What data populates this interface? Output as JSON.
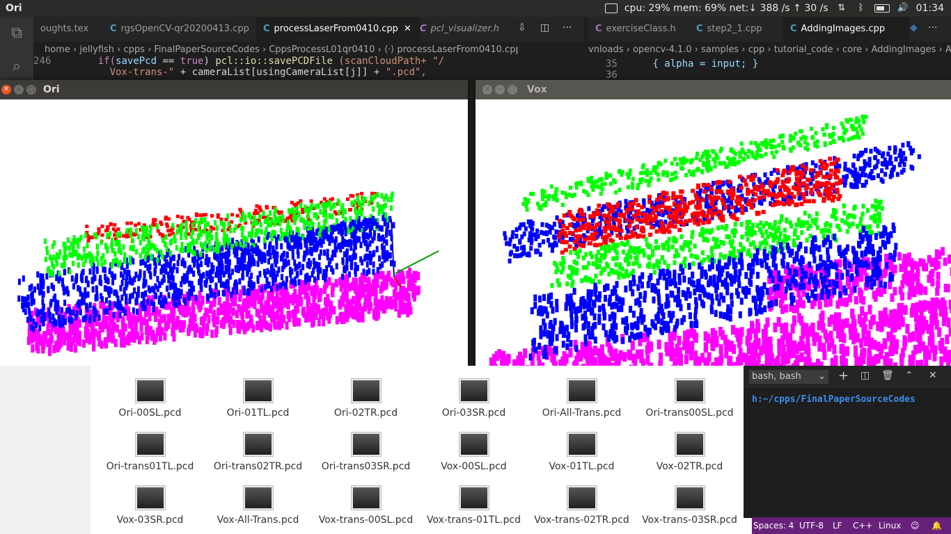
{
  "top_panel": {
    "app_name": "Ori",
    "status": "cpu: 29% mem: 69% net:↓  388 /s ↑   30 /s",
    "clock": "01:34"
  },
  "editor_left": {
    "tabs": [
      {
        "label": "oughts.tex"
      },
      {
        "label": "rgsOpenCV-qr20200413.cpp"
      },
      {
        "label": "processLaserFrom0410.cpp",
        "active": true
      },
      {
        "label": "pcl_visualizer.h"
      }
    ],
    "breadcrumb": "home › jellyfish › cpps › FinalPaperSourceCodes › CppsProcessL01qr0410 › ⟨·⟩ processLaserFrom0410.cpp › …",
    "line_number": "246",
    "code_line1": {
      "a": "if(",
      "b": "savePcd",
      "c": " == ",
      "d": "true",
      "e": ") ",
      "f": "pcl::io::savePCDFile",
      "g": " (scanCloudPath+ \"/"
    },
    "code_line2": {
      "a": "Vox-trans-\"",
      "b": " + cameraList[usingCameraList[j]] + ",
      "c": "\".pcd\","
    }
  },
  "editor_right": {
    "tabs": [
      {
        "label": "exerciseClass.h"
      },
      {
        "label": "step2_1.cpp"
      },
      {
        "label": "AddingImages.cpp",
        "active": true
      }
    ],
    "breadcrumb": "vnloads › opencv-4.1.0 › samples › cpp › tutorial_code › core › AddingImages › Ad",
    "line_number": "35",
    "line_number2": "36",
    "code": "{ alpha = input; }"
  },
  "windows": {
    "ori": {
      "title": "Ori"
    },
    "vox": {
      "title": "Vox"
    }
  },
  "files": [
    "Ori-00SL.pcd",
    "Ori-01TL.pcd",
    "Ori-02TR.pcd",
    "Ori-03SR.pcd",
    "Ori-All-Trans.pcd",
    "Ori-trans00SL.pcd",
    "Ori-trans01TL.pcd",
    "Ori-trans02TR.pcd",
    "Ori-trans03SR.pcd",
    "Vox-00SL.pcd",
    "Vox-01TL.pcd",
    "Vox-02TR.pcd",
    "Vox-03SR.pcd",
    "Vox-All-Trans.pcd",
    "Vox-trans-00SL.pcd",
    "Vox-trans-01TL.pcd",
    "Vox-trans-02TR.pcd",
    "Vox-trans-03SR.pcd"
  ],
  "terminal": {
    "shell_label": "bash, bash",
    "path": "h:~/cpps/FinalPaperSourceCodes"
  },
  "statusbar": {
    "spaces": "Spaces: 4",
    "encoding": "UTF-8",
    "eol": "LF",
    "language": "C++",
    "os": "Linux"
  },
  "colors": {
    "red": "#ff0000",
    "green": "#00ff00",
    "blue": "#0000ff",
    "magenta": "#ff00ff"
  }
}
